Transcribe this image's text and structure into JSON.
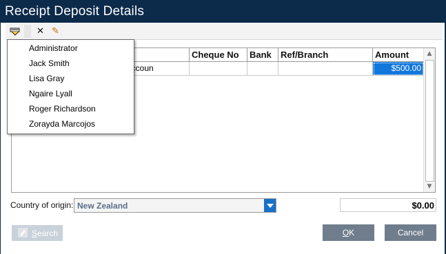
{
  "window": {
    "title": "Receipt Deposit Details"
  },
  "toolbar": {
    "icons": [
      "users-dropdown-icon",
      "delete-icon",
      "edit-icon"
    ],
    "delete_glyph": "✕",
    "edit_glyph": "✎"
  },
  "grid": {
    "columns": [
      "",
      "Cheque No",
      "Bank",
      "Ref/Branch",
      "Amount"
    ],
    "rows": [
      {
        "description": "n accoun",
        "cheque_no": "",
        "bank": "",
        "ref_branch": "",
        "amount": "$500.00"
      }
    ]
  },
  "user_menu": {
    "items": [
      {
        "label": "Administrator",
        "mnemonic": "A"
      },
      {
        "label": "Jack Smith",
        "mnemonic": "J"
      },
      {
        "label": "Lisa Gray",
        "mnemonic": "L"
      },
      {
        "label": "Ngaire Lyall",
        "mnemonic": "N"
      },
      {
        "label": "Roger Richardson",
        "mnemonic": "R"
      },
      {
        "label": "Zorayda Marcojos",
        "mnemonic": "Z"
      }
    ]
  },
  "country": {
    "label": "Country of origin:",
    "value": "New Zealand"
  },
  "total": "$0.00",
  "buttons": {
    "search": "Search",
    "ok": "OK",
    "cancel": "Cancel"
  },
  "colors": {
    "titlebar": "#0c2a4a",
    "selected_cell": "#1177dd",
    "button": "#6f7d8c",
    "combo_button": "#1a6fc8"
  }
}
